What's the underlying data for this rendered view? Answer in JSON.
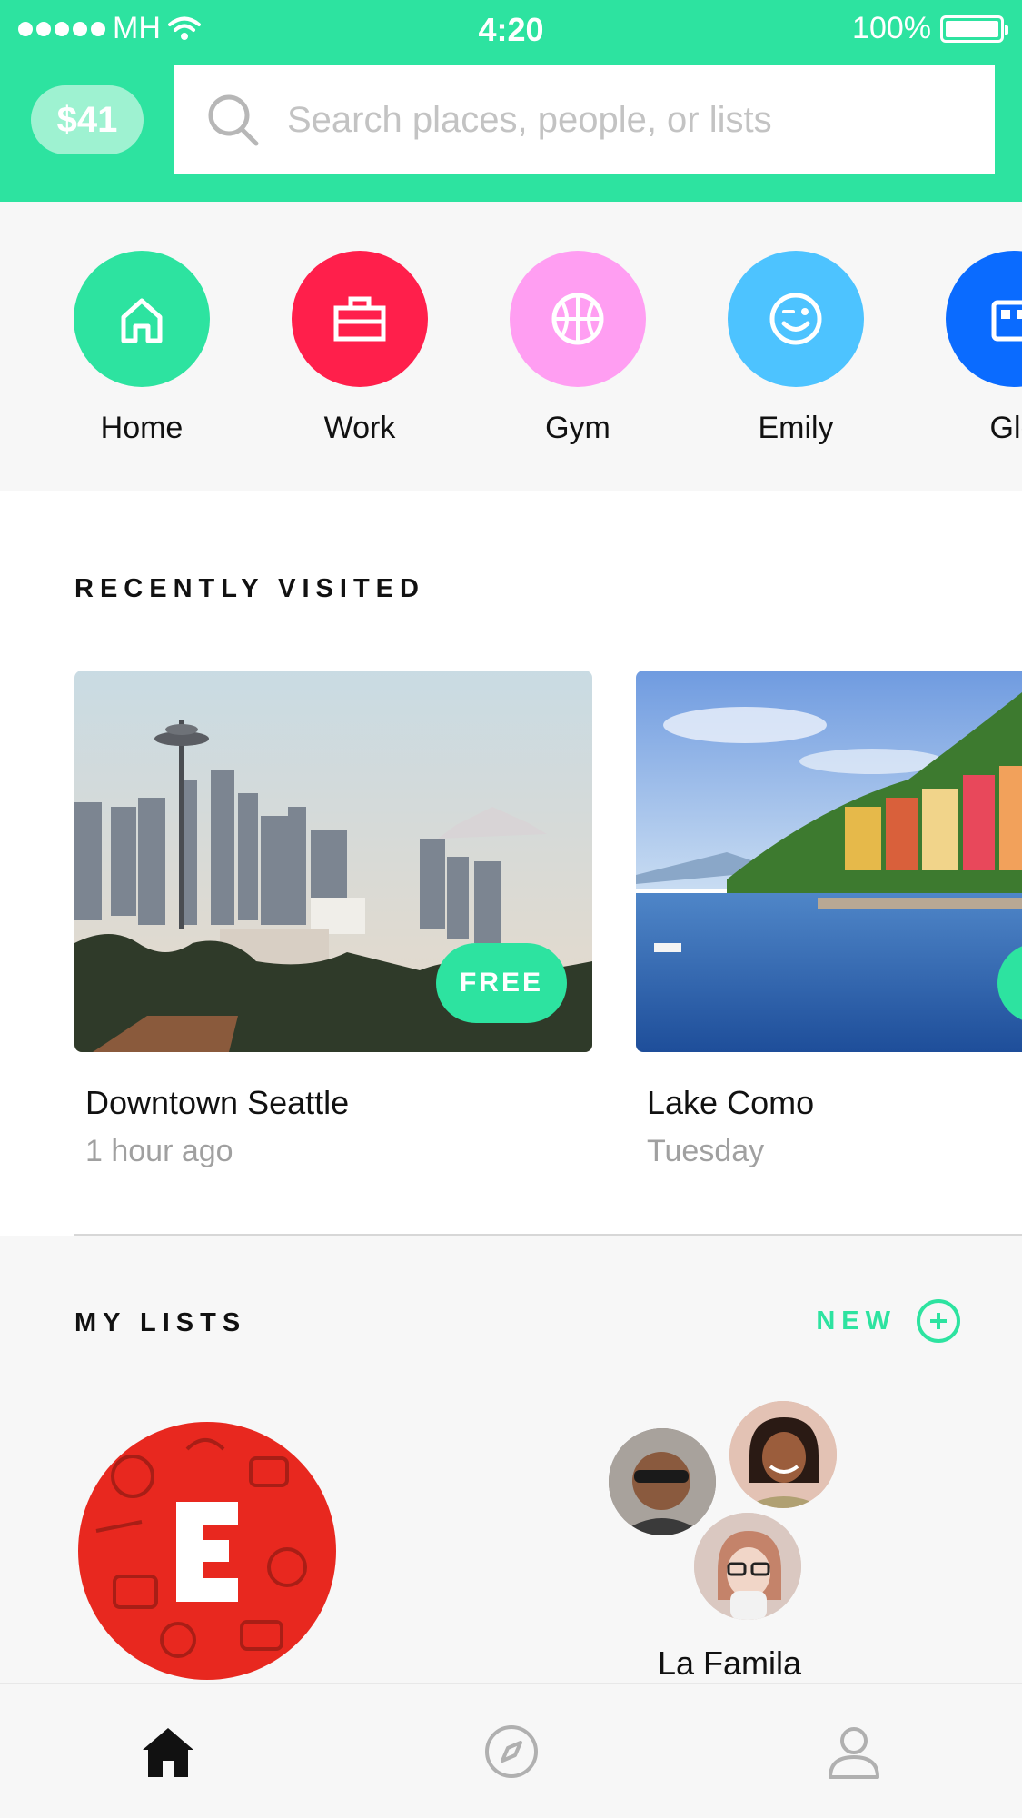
{
  "status_bar": {
    "carrier": "MH",
    "time": "4:20",
    "battery": "100%"
  },
  "header": {
    "balance": "$41",
    "search_placeholder": "Search places, people, or lists",
    "accent_color": "#2de3a0"
  },
  "shortcuts": [
    {
      "label": "Home",
      "color": "#2de3a0",
      "icon": "house-icon"
    },
    {
      "label": "Work",
      "color": "#ff1f4b",
      "icon": "briefcase-icon"
    },
    {
      "label": "Gym",
      "color": "#ff9ef2",
      "icon": "basketball-icon"
    },
    {
      "label": "Emily",
      "color": "#4dc3ff",
      "icon": "wink-face-icon"
    },
    {
      "label": "Gle",
      "color": "#0a6bff",
      "icon": "building-icon"
    }
  ],
  "recently_visited": {
    "title": "RECENTLY VISITED",
    "cards": [
      {
        "name": "Downtown Seattle",
        "when": "1 hour ago",
        "badge": "FREE"
      },
      {
        "name": "Lake Como",
        "when": "Tuesday"
      }
    ]
  },
  "my_lists": {
    "title": "MY LISTS",
    "new_label": "NEW",
    "lists": [
      {
        "letter": "E",
        "name": ""
      },
      {
        "name": "La Famila"
      }
    ]
  },
  "tabbar": {
    "tabs": [
      "home-icon",
      "compass-icon",
      "profile-icon"
    ],
    "active": "home-icon"
  }
}
